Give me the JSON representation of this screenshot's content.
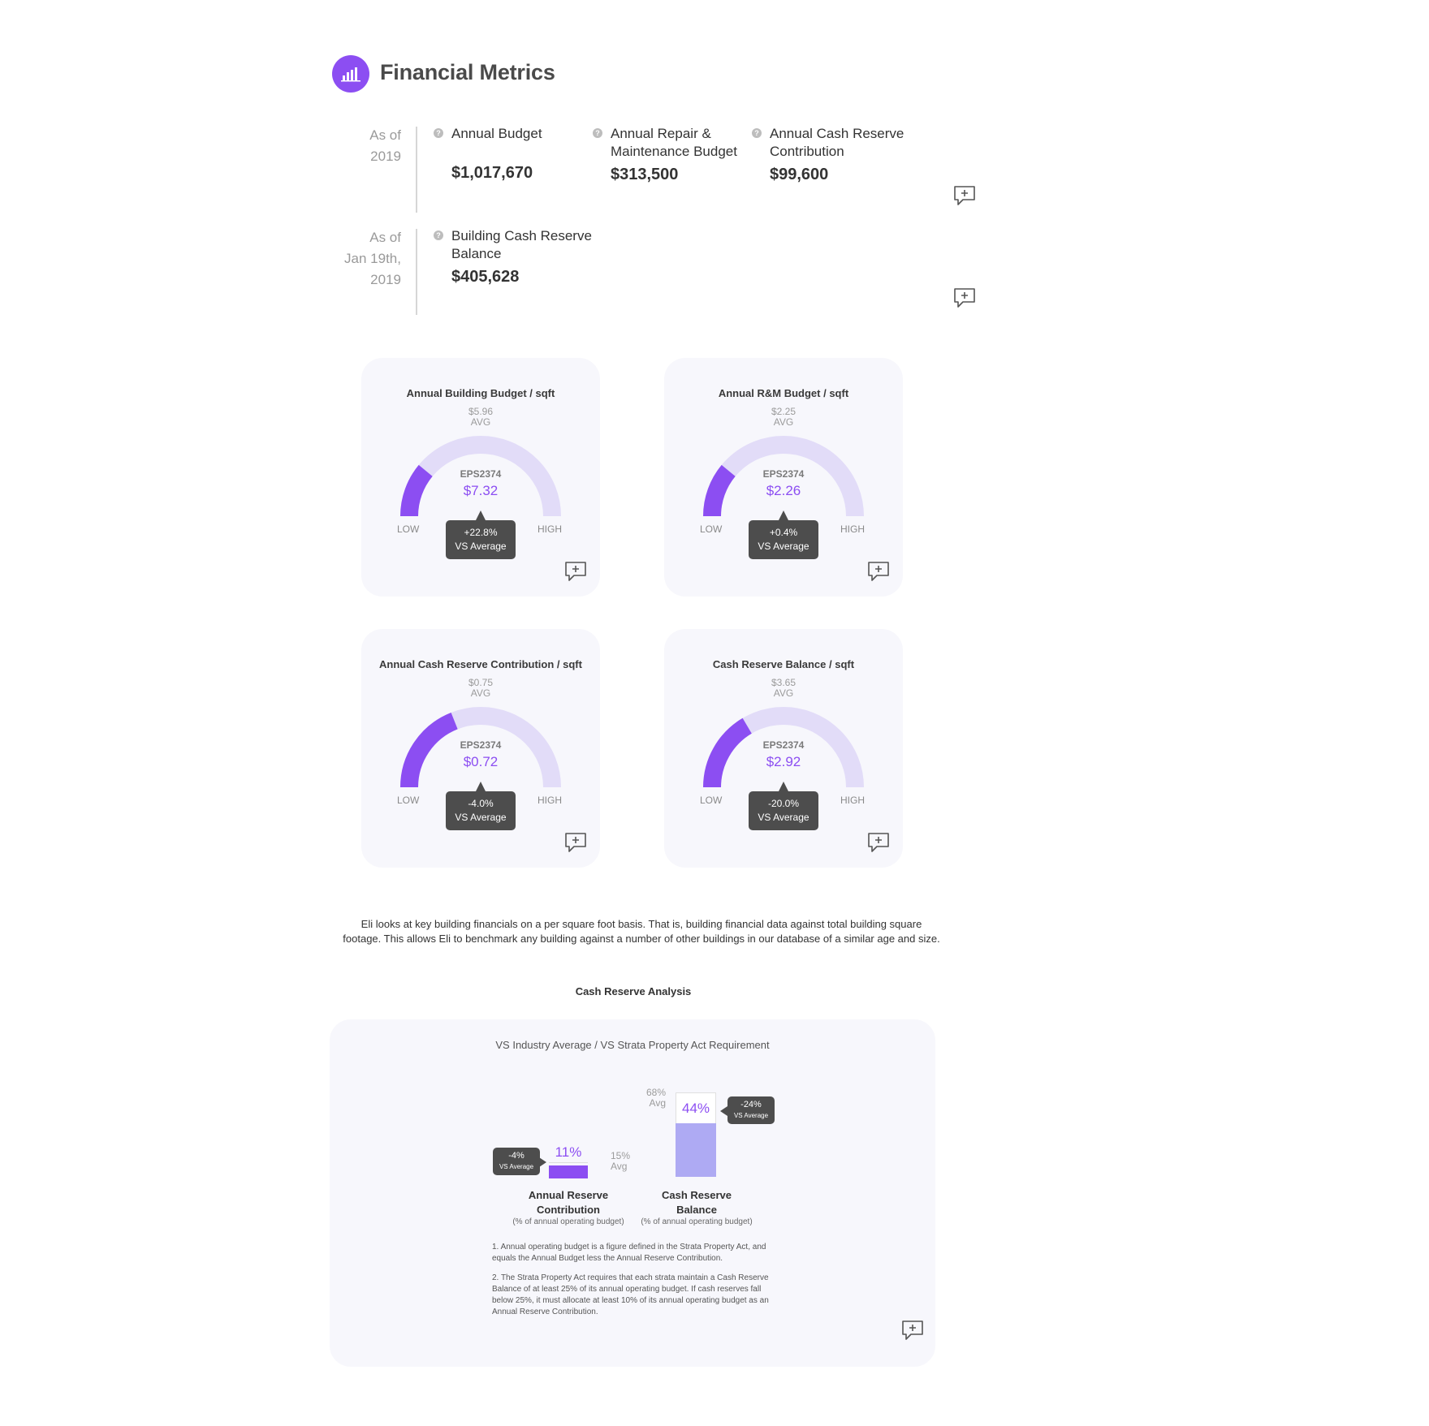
{
  "header": {
    "title": "Financial Metrics",
    "icon": "bar-chart-icon",
    "accent": "#8c4ef2"
  },
  "metrics_2019": {
    "asof": [
      "As of",
      "2019"
    ],
    "items": [
      {
        "label": "Annual Budget",
        "value": "$1,017,670"
      },
      {
        "label": "Annual Repair &",
        "label2": "Maintenance Budget",
        "value": "$313,500"
      },
      {
        "label": "Annual Cash Reserve",
        "label2": "Contribution",
        "value": "$99,600"
      }
    ]
  },
  "metrics_jan": {
    "asof": [
      "As of",
      "Jan 19th,",
      "2019"
    ],
    "items": [
      {
        "label": "Building Cash Reserve",
        "label2": "Balance",
        "value": "$405,628"
      }
    ]
  },
  "gauges": [
    {
      "title": "Annual Building Budget / sqft",
      "avg": "$5.96",
      "avg_label": "AVG",
      "id": "EPS2374",
      "value": "$7.32",
      "low": "LOW",
      "high": "HIGH",
      "delta": "+22.8%",
      "delta_label": "VS Average",
      "fill_fraction": 0.22
    },
    {
      "title": "Annual R&M Budget / sqft",
      "avg": "$2.25",
      "avg_label": "AVG",
      "id": "EPS2374",
      "value": "$2.26",
      "low": "LOW",
      "high": "HIGH",
      "delta": "+0.4%",
      "delta_label": "VS Average",
      "fill_fraction": 0.22
    },
    {
      "title": "Annual Cash Reserve Contribution / sqft",
      "avg": "$0.75",
      "avg_label": "AVG",
      "id": "EPS2374",
      "value": "$0.72",
      "low": "LOW",
      "high": "HIGH",
      "delta": "-4.0%",
      "delta_label": "VS Average",
      "fill_fraction": 0.38
    },
    {
      "title": "Cash Reserve Balance / sqft",
      "avg": "$3.65",
      "avg_label": "AVG",
      "id": "EPS2374",
      "value": "$2.92",
      "low": "LOW",
      "high": "HIGH",
      "delta": "-20.0%",
      "delta_label": "VS Average",
      "fill_fraction": 0.33
    }
  ],
  "paragraph": {
    "line1": "Eli looks at key building financials on a per square foot basis. That is, building financial data against total building square",
    "line2": "footage. This allows Eli to benchmark any building against a number of other buildings in our database of a similar age and size."
  },
  "cash_reserve": {
    "title": "Cash Reserve Analysis",
    "subtitle": "VS Industry Average / VS Strata Property Act Requirement",
    "bars": [
      {
        "value": "11%",
        "avg": "15%",
        "avg_label": "Avg",
        "delta": "-4%",
        "delta_label": "VS Average",
        "label1": "Annual Reserve",
        "label2": "Contribution",
        "sub": "(% of annual operating budget)"
      },
      {
        "value": "44%",
        "avg": "68%",
        "avg_label": "Avg",
        "delta": "-24%",
        "delta_label": "VS Average",
        "label1": "Cash Reserve",
        "label2": "Balance",
        "sub": "(% of annual operating budget)"
      }
    ],
    "notes": [
      [
        "1. Annual operating budget is a figure defined in the Strata Property Act, and",
        "equals the Annual Budget less the Annual Reserve Contribution."
      ],
      [
        "2. The Strata Property Act requires that each strata maintain a Cash Reserve",
        "Balance of at least 25% of its annual operating budget. If cash reserves fall",
        "below 25%, it must allocate at least 10% of its annual operating budget as an",
        "Annual Reserve Contribution."
      ]
    ]
  },
  "colors": {
    "purple": "#8c4ef2",
    "light_purple": "#e2dcf8",
    "bar_light": "#aeaaf3",
    "dark_tip": "#4d4d4d"
  }
}
